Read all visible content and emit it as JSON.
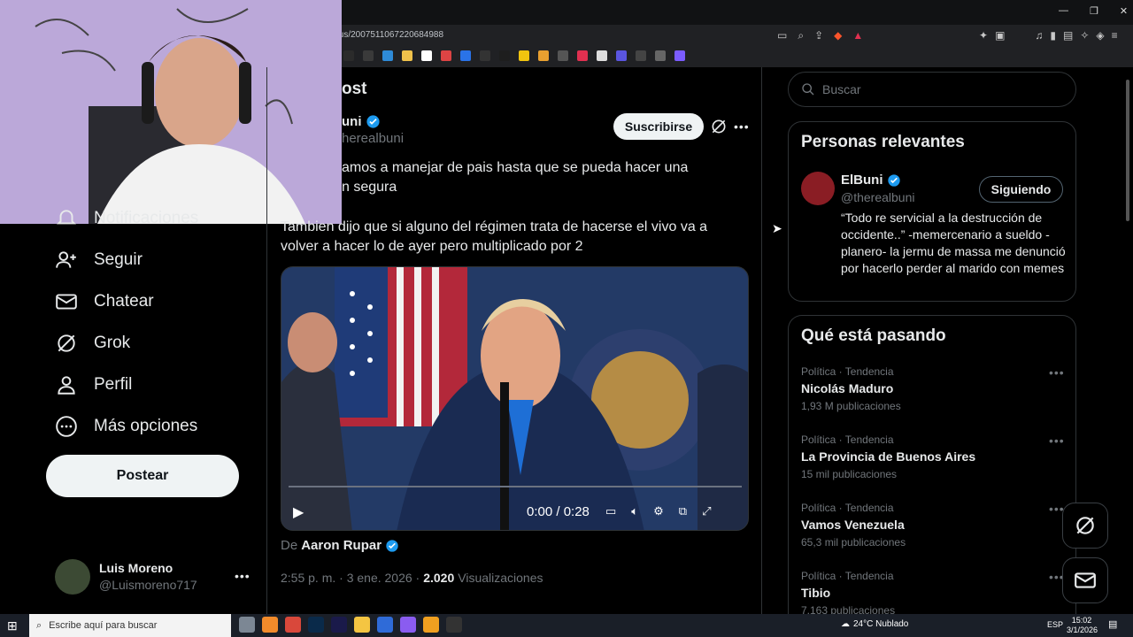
{
  "browser": {
    "url": "tus/2007511067220684988",
    "bookmark_colors": [
      "#2b2b2b",
      "#3a3a3a",
      "#2e8bd8",
      "#f0c24b",
      "#fff",
      "#d44",
      "#2a73e8",
      "#333",
      "#1e1e1e",
      "#f1c40f",
      "#e8a030",
      "#555",
      "#e03050",
      "#ddd",
      "#5a55e0",
      "#444",
      "#666",
      "#7b5cff"
    ]
  },
  "webcam": {
    "label": "webcam-overlay"
  },
  "nav": {
    "notifications_label": "Notificaciones",
    "follow_label": "Seguir",
    "chat_label": "Chatear",
    "grok_label": "Grok",
    "profile_label": "Perfil",
    "more_label": "Más opciones",
    "post_label": "Postear"
  },
  "account": {
    "name": "Luis Moreno",
    "handle": "@Luismoreno717"
  },
  "post": {
    "header": "ost",
    "author_name": "uni",
    "author_handle": "herealbuni",
    "subscribe_label": "Suscribirse",
    "text_line1": "amos a manejar de pais hasta que se pueda hacer una",
    "text_line2": "n segura",
    "text_para2_line1": "Tambien dijo que si alguno del régimen trata de hacerse el vivo va a",
    "text_para2_line2": "volver a hacer lo de ayer pero multiplicado por 2",
    "video_time": "0:00 / 0:28",
    "video_progress": 0,
    "from_prefix": "De",
    "from_name": "Aaron Rupar",
    "timestamp": "2:55 p. m. · 3 ene. 2026 ·",
    "views_count": "2.020",
    "views_label": "Visualizaciones"
  },
  "search": {
    "placeholder": "Buscar"
  },
  "relevant": {
    "title": "Personas relevantes",
    "name": "ElBuni",
    "handle": "@therealbuni",
    "follow_state": "Siguiendo",
    "bio": "“Todo re servicial a la destrucción de occidente..” -memercenario a sueldo - planero- la jermu de massa me denunció por hacerlo perder al marido con memes"
  },
  "trends": {
    "title": "Qué está pasando",
    "items": [
      {
        "meta": "Política · Tendencia",
        "name": "Nicolás Maduro",
        "count": "1,93 M publicaciones"
      },
      {
        "meta": "Política · Tendencia",
        "name": "La Provincia de Buenos Aires",
        "count": "15 mil publicaciones"
      },
      {
        "meta": "Política · Tendencia",
        "name": "Vamos Venezuela",
        "count": "65,3 mil publicaciones"
      },
      {
        "meta": "Política · Tendencia",
        "name": "Tibio",
        "count": "7.163 publicaciones"
      }
    ]
  },
  "taskbar": {
    "search_placeholder": "Escribe aquí para buscar",
    "weather": "24°C  Nublado",
    "lang": "ESP",
    "time": "15:02",
    "date": "3/1/2026"
  }
}
